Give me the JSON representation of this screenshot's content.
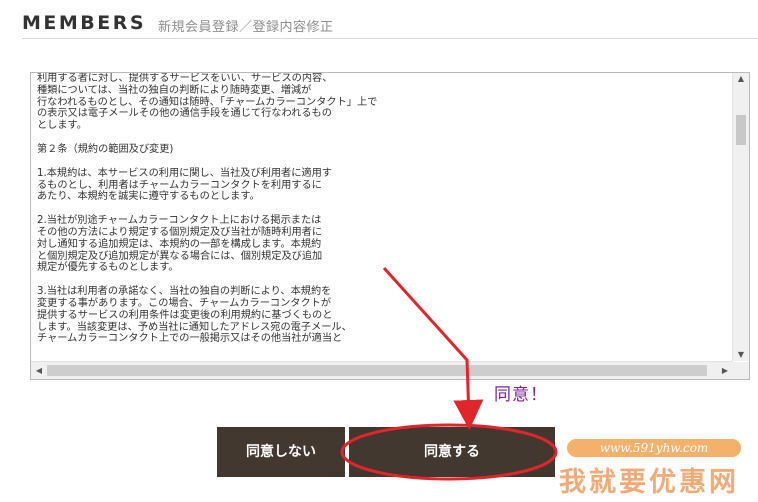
{
  "header": {
    "brand": "MEMBERS",
    "subtitle": "新規会員登録／登録内容修正"
  },
  "terms": {
    "paragraphs": [
      "利用する者に対し、提供するサービスをいい、サービスの内容、\n種類については、当社の独自の判断により随時変更、増減が\n行なわれるものとし、その通知は随時、「チャームカラーコンタクト」上で\nの表示又は電子メールその他の通信手段を通じて行なわれるもの\nとします。",
      "第２条（規約の範囲及び変更)",
      "1.本規約は、本サービスの利用に関し、当社及び利用者に適用す\nるものとし、利用者はチャームカラーコンタクトを利用するに\nあたり、本規約を誠実に遵守するものとします。",
      "2.当社が別途チャームカラーコンタクト上における掲示または\nその他の方法により規定する個別規定及び当社が随時利用者に\n対し通知する追加規定は、本規約の一部を構成します。本規約\nと個別規定及び追加規定が異なる場合には、個別規定及び追加\n規定が優先するものとします。",
      "3.当社は利用者の承諾なく、当社の独自の判断により、本規約を\n変更する事があります。この場合、チャームカラーコンタクトが\n提供するサービスの利用条件は変更後の利用規約に基づくものと\nします。当該変更は、予め当社に通知したアドレス宛の電子メール、\nチャームカラーコンタクト上での一般掲示又はその他当社が適当と"
    ]
  },
  "scroll": {
    "up": "▲",
    "down": "▼",
    "left": "◀",
    "right": "▶"
  },
  "annotation": "同意！",
  "buttons": {
    "decline": "同意しない",
    "agree": "同意する"
  },
  "watermark": {
    "url": "www.591yhw.com",
    "name": "我就要优惠网"
  },
  "colors": {
    "button_bg": "#43382f",
    "annotation": "#7a1fa2",
    "highlight": "#e0262a",
    "watermark": "#f1a36a"
  }
}
